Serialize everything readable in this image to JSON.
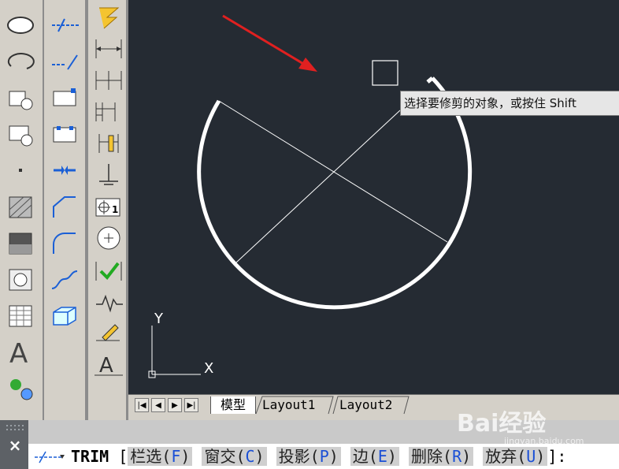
{
  "tooltip": {
    "text": "选择要修剪的对象，或按住 Shift"
  },
  "ucs": {
    "x_label": "X",
    "y_label": "Y"
  },
  "layout_tabs": [
    {
      "label": "模型",
      "active": true
    },
    {
      "label": "Layout1",
      "active": false
    },
    {
      "label": "Layout2",
      "active": false
    }
  ],
  "tab_nav": {
    "first": "|◀",
    "prev": "◀",
    "next": "▶",
    "last": "▶|"
  },
  "command": {
    "close": "×",
    "name": "TRIM",
    "open_bracket": "[",
    "options": [
      {
        "text": "栏选(",
        "key": "F",
        "close": ")"
      },
      {
        "text": "窗交(",
        "key": "C",
        "close": ")"
      },
      {
        "text": "投影(",
        "key": "P",
        "close": ")"
      },
      {
        "text": "边(",
        "key": "E",
        "close": ")"
      },
      {
        "text": "删除(",
        "key": "R",
        "close": ")"
      },
      {
        "text": "放弃(",
        "key": "U",
        "close": ")"
      }
    ],
    "end": "]:"
  },
  "watermark": {
    "text": "Bai经验",
    "sub": "jingyan.baidu.com"
  },
  "colors": {
    "canvas_bg": "#252b33",
    "arrow": "#e02020",
    "geometry": "#ffffff",
    "key": "#1a4fd6"
  },
  "icons_col1": [
    "ellipse-icon",
    "ellipse-arc-icon",
    "insert-block-icon",
    "make-block-icon",
    "point-icon",
    "hatch-icon",
    "gradient-icon",
    "region-icon",
    "table-icon",
    "multiline-text-icon",
    "add-selected-icon"
  ],
  "icons_col2": [
    "xline-icon",
    "ray-icon",
    "wipeout-icon",
    "region-box-icon",
    "join-icon",
    "chamfer-icon",
    "fillet-icon",
    "blend-curves-icon",
    "3d-box-icon"
  ],
  "icons_col3": [
    "quick-dimension-icon",
    "linear-dimension-icon",
    "continue-dimension-icon",
    "baseline-dimension-icon",
    "ordinate-dimension-icon",
    "tolerance-icon",
    "center-mark-icon",
    "inspect-icon",
    "jogged-linear-icon",
    "dimension-edit-icon",
    "dimension-text-edit-icon",
    "dimension-update-icon"
  ]
}
